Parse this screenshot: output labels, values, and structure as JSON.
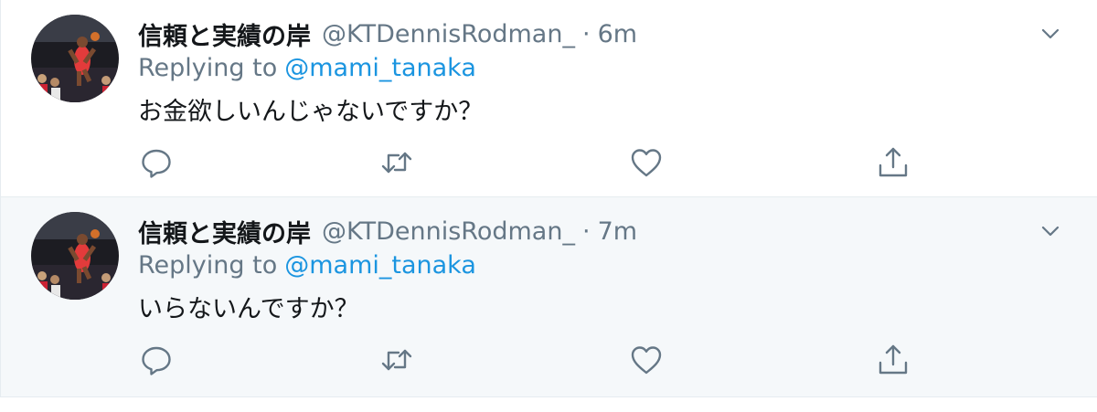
{
  "colors": {
    "name": "#14171a",
    "secondary": "#657786",
    "link": "#1b95e0",
    "highlight_bg": "#f5f8fa",
    "border": "#e6ecf0"
  },
  "icons": {
    "more": "chevron-down-icon",
    "reply": "reply-icon",
    "retweet": "retweet-icon",
    "like": "heart-icon",
    "share": "share-icon"
  },
  "tweets": [
    {
      "display_name": "信頼と実績の岸",
      "handle": "@KTDennisRodman_",
      "separator": "·",
      "time": "6m",
      "replying_label": "Replying to",
      "replying_to": "@mami_tanaka",
      "text": "お金欲しいんじゃないですか？"
    },
    {
      "display_name": "信頼と実績の岸",
      "handle": "@KTDennisRodman_",
      "separator": "·",
      "time": "7m",
      "replying_label": "Replying to",
      "replying_to": "@mami_tanaka",
      "text": "いらないんですか？"
    }
  ]
}
